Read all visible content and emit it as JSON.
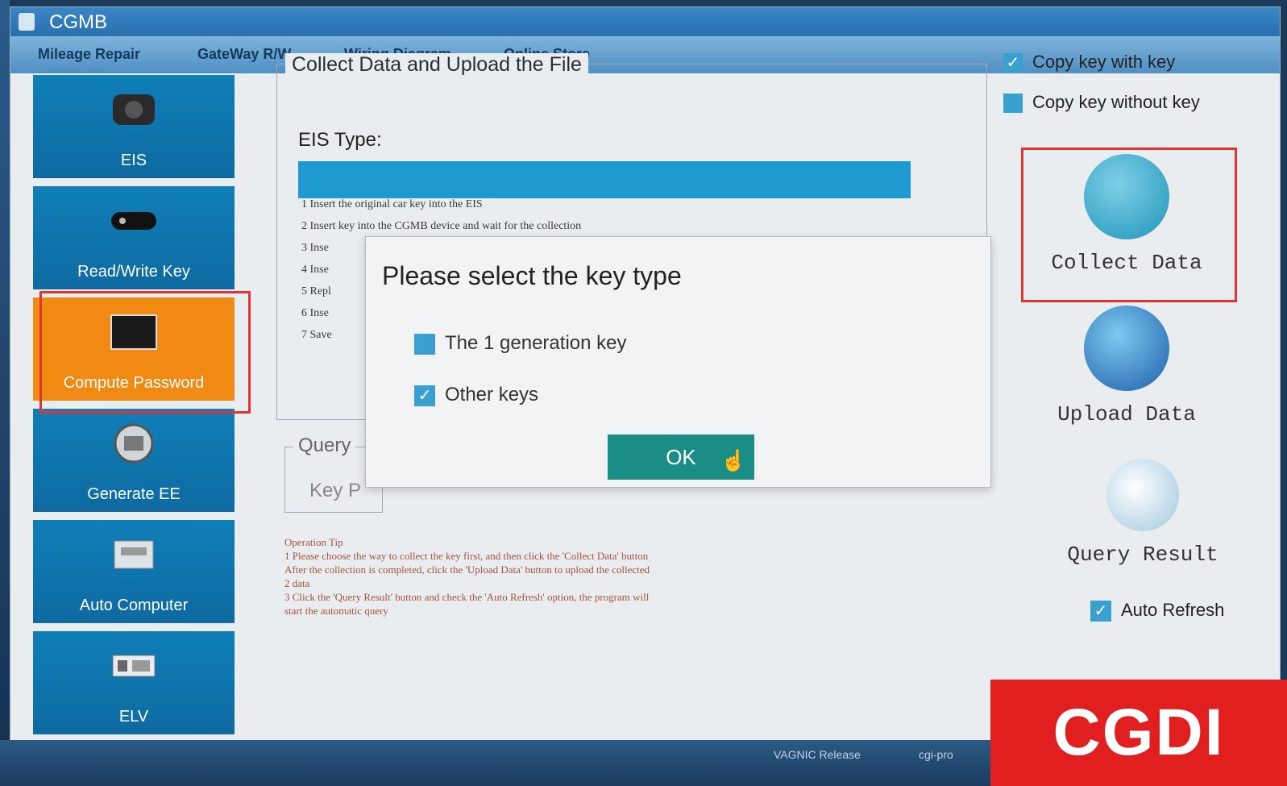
{
  "window": {
    "title": "CGMB"
  },
  "menu": [
    "Mileage Repair",
    "GateWay R/W",
    "Wiring Diagram",
    "Online Store"
  ],
  "sidebar": {
    "items": [
      {
        "label": "EIS",
        "icon": "eis-module-icon"
      },
      {
        "label": "Read/Write Key",
        "icon": "car-key-icon"
      },
      {
        "label": "Compute Password",
        "icon": "laptop-icon",
        "active": true
      },
      {
        "label": "Generate EE",
        "icon": "chip-icon"
      },
      {
        "label": "Auto Computer",
        "icon": "ecu-icon"
      },
      {
        "label": "ELV",
        "icon": "elv-module-icon"
      }
    ]
  },
  "main": {
    "group_title": "Collect Data and Upload the File",
    "eis_type_label": "EIS Type:",
    "steps": [
      "1 Insert the original car key into the EIS",
      "2 Insert key into the CGMB device and wait for the collection",
      "3 Inse",
      "4 Inse",
      "5 Repl",
      "6 Inse",
      "7 Save"
    ],
    "query_title": "Query",
    "query_key_partial": "Key P",
    "tips": {
      "title": "Operation Tip",
      "lines": [
        "1  Please choose the way to collect the key first, and then click the 'Collect Data' button",
        "   After the collection is completed, click the 'Upload Data' button to upload the collected",
        "2  data",
        "3  Click the 'Query Result' button and check the 'Auto Refresh' option, the program will",
        "   start the automatic query"
      ]
    }
  },
  "dialog": {
    "title": "Please select the key type",
    "options": [
      {
        "label": "The 1 generation key",
        "checked": false
      },
      {
        "label": "Other keys",
        "checked": true
      }
    ],
    "ok_label": "OK"
  },
  "right_panel": {
    "copy_with_key": {
      "label": "Copy key with key",
      "checked": true
    },
    "copy_without_key": {
      "label": "Copy key without key",
      "checked": false
    },
    "collect_data": "Collect Data",
    "upload_data": "Upload  Data",
    "query_result": "Query Result",
    "auto_refresh": {
      "label": "Auto Refresh",
      "checked": true
    }
  },
  "taskbar_text": [
    "VAGNIC Release",
    "cgi-pro"
  ],
  "logo_text": "CGDI",
  "colors": {
    "sidebar_blue": "#0f7fb8",
    "sidebar_active": "#f08a12",
    "highlight_red": "#e23333",
    "ok_button": "#198d86",
    "logo_red": "#e21f1f"
  }
}
